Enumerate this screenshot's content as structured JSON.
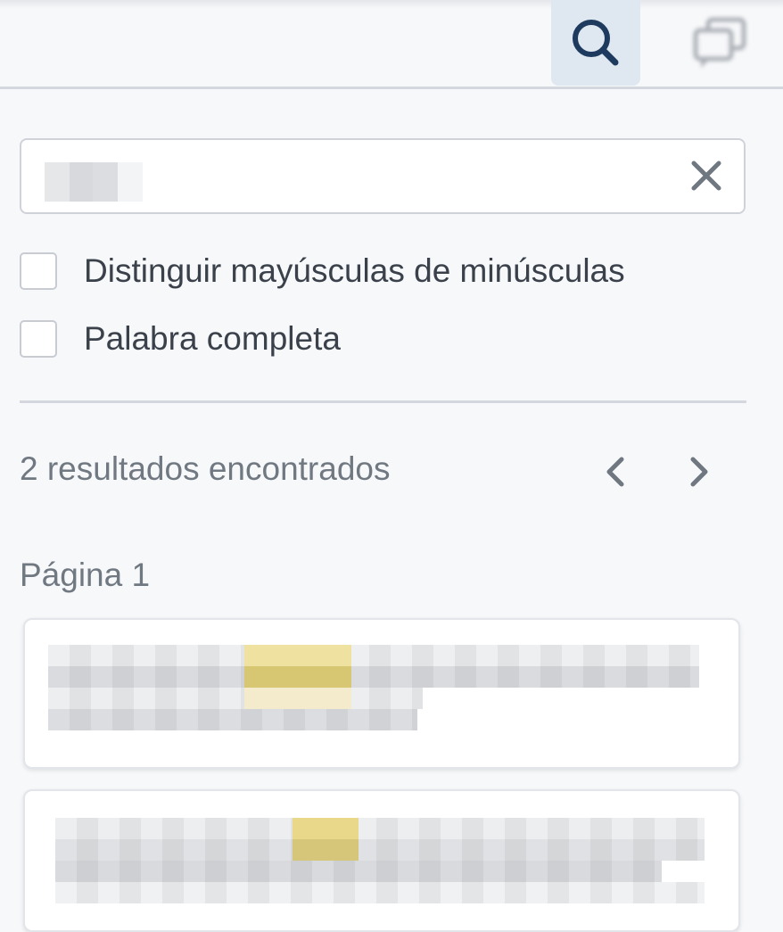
{
  "toolbar": {
    "search_button_icon": "search-icon",
    "notes_button_icon": "comments-icon"
  },
  "search": {
    "query": "",
    "clear_icon": "close-icon"
  },
  "options": [
    {
      "label": "Distinguir mayúsculas de minúsculas",
      "checked": false
    },
    {
      "label": "Palabra completa",
      "checked": false
    }
  ],
  "results": {
    "count_text": "2 resultados encontrados",
    "prev_icon": "chevron-left-icon",
    "next_icon": "chevron-right-icon",
    "page_label": "Página 1"
  },
  "colors": {
    "accent": "#1e3a5f",
    "highlight": "#e7d37a",
    "icon_gray": "#6f7780"
  }
}
